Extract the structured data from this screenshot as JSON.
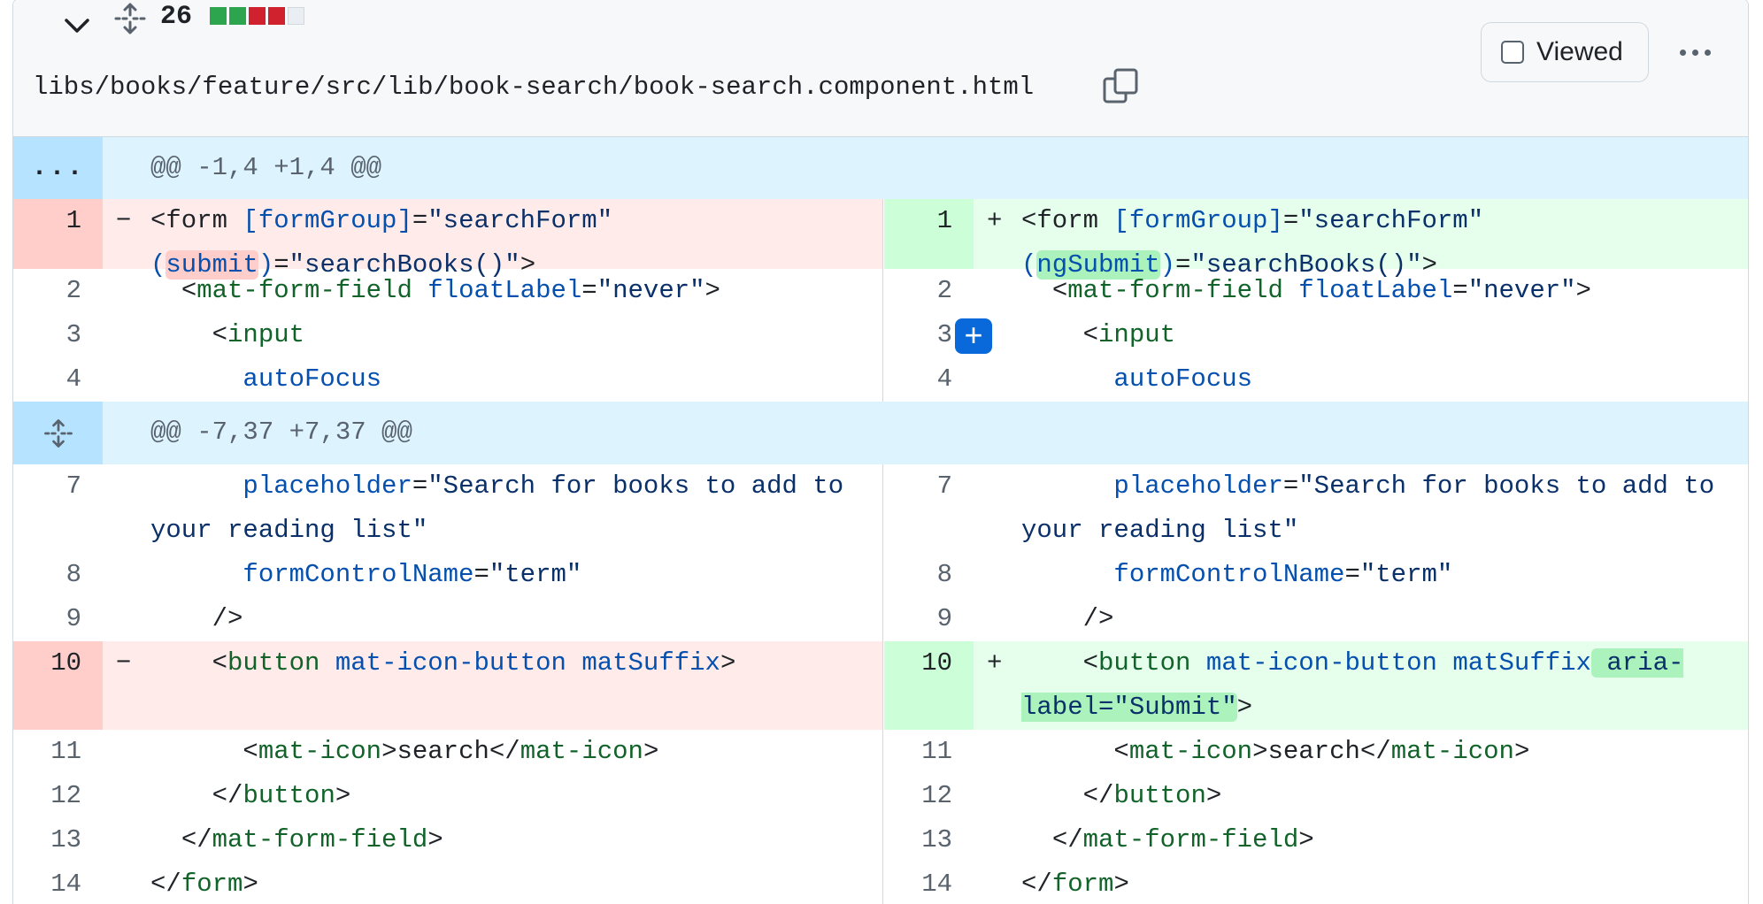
{
  "file": {
    "line_count": "26",
    "path": "libs/books/feature/src/lib/book-search/book-search.component.html",
    "viewed_label": "Viewed",
    "diffstat_colors": [
      "#2da44e",
      "#2da44e",
      "#cf222e",
      "#cf222e",
      "#eaeef2"
    ],
    "icons": [
      "chevron-down-icon",
      "unfold-icon",
      "copy-icon",
      "kebab-horizontal-icon",
      "checkbox-icon",
      "plus-icon"
    ]
  },
  "hunks": {
    "h1_gutter": "...",
    "h1_text": "@@ -1,4 +1,4 @@",
    "h2_text": "@@ -7,37 +7,37 @@"
  },
  "markers": {
    "del": "−",
    "add": "+"
  },
  "lines": {
    "l1": {
      "left_num": "1",
      "right_num": "1",
      "form_open": "<form ",
      "form_attr": "[formGroup]",
      "eq": "=",
      "form_val": "\"searchForm\"",
      "nl": "\n",
      "paren_open": "(",
      "submit_old": "submit",
      "submit_new": "ngSubmit",
      "paren_close": ")",
      "eq2": "=",
      "submit_val": "\"searchBooks()\"",
      "close": ">"
    },
    "l2": {
      "num": "2",
      "indent": "  ",
      "lt": "<",
      "tag": "mat-form-field",
      "sp": " ",
      "attr": "floatLabel",
      "eq": "=",
      "val": "\"never\"",
      "gt": ">"
    },
    "l3": {
      "num": "3",
      "indent": "    ",
      "lt": "<",
      "tag": "input"
    },
    "l4": {
      "num": "4",
      "indent": "      ",
      "attr": "autoFocus"
    },
    "l7": {
      "num": "7",
      "indent": "      ",
      "attr": "placeholder",
      "eq": "=",
      "val": "\"Search for books to add to your reading list\""
    },
    "l8": {
      "num": "8",
      "indent": "      ",
      "attr": "formControlName",
      "eq": "=",
      "val": "\"term\""
    },
    "l9": {
      "num": "9",
      "indent": "    ",
      "text": "/>"
    },
    "l10": {
      "num": "10",
      "indent": "    ",
      "lt": "<",
      "tag": "button",
      "sp1": " ",
      "attr1": "mat-icon-button",
      "sp2": " ",
      "attr2": "matSuffix",
      "added": " aria-label=\"Submit\"",
      "gt": ">"
    },
    "l11": {
      "num": "11",
      "indent": "      ",
      "lt": "<",
      "tag": "mat-icon",
      "gt": ">",
      "text": "search",
      "lt2": "</",
      "tag2": "mat-icon",
      "gt2": ">"
    },
    "l12": {
      "num": "12",
      "indent": "    ",
      "lt": "</",
      "tag": "button",
      "gt": ">"
    },
    "l13": {
      "num": "13",
      "indent": "  ",
      "lt": "</",
      "tag": "mat-form-field",
      "gt": ">"
    },
    "l14": {
      "num": "14",
      "lt": "</",
      "tag": "form",
      "gt": ">"
    }
  }
}
